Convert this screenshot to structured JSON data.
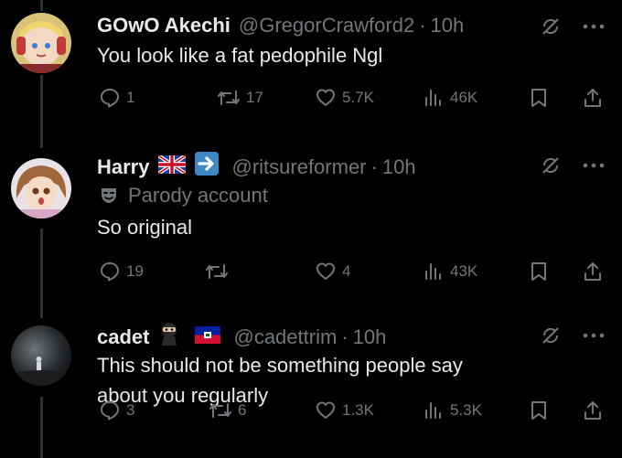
{
  "replies": [
    {
      "name": "GOwO Akechi",
      "handle": "@GregorCrawford2",
      "time": "10h",
      "body": "You look like a fat pedophile Ngl",
      "reply_count": "1",
      "retweet_count": "17",
      "like_count": "5.7K",
      "view_count": "46K"
    },
    {
      "name": "Harry",
      "badges": [
        "uk-flag-icon",
        "right-arrow-icon"
      ],
      "handle": "@ritsureformer",
      "time": "10h",
      "parody_label": "Parody account",
      "body": "So original",
      "reply_count": "19",
      "retweet_count": "",
      "like_count": "4",
      "view_count": "43K"
    },
    {
      "name": "cadet",
      "badges": [
        "ninja-icon",
        "haiti-flag-icon"
      ],
      "handle": "@cadettrim",
      "time": "10h",
      "body_lines": [
        "This should not be something people say",
        "about you regularly"
      ],
      "reply_count": "3",
      "retweet_count": "6",
      "like_count": "1.3K",
      "view_count": "5.3K"
    }
  ],
  "separator": "·",
  "colors": {
    "background": "#000000",
    "text_primary": "#e7e9ea",
    "text_secondary": "#71767b",
    "thread_line": "#2f3336"
  }
}
